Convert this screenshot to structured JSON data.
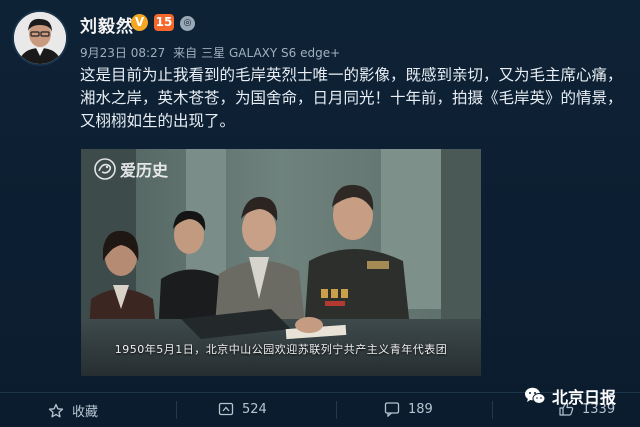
{
  "post": {
    "username": "刘毅然",
    "badge_v": "V",
    "badge_level": "15",
    "time": "9月23日 08:27",
    "source_prefix": "来自",
    "device": "三星 GALAXY S6 edge+",
    "text": "这是目前为止我看到的毛岸英烈士唯一的影像，既感到亲切，又为毛主席心痛，湘水之岸，英木苍苍，为国舍命，日月同光！十年前，拍摄《毛岸英》的情景，又栩栩如生的出现了。"
  },
  "video": {
    "logo_text": "爱历史",
    "subtitle": "1950年5月1日，北京中山公园欢迎苏联列宁共产主义青年代表团"
  },
  "toolbar": {
    "favorite_label": "收藏",
    "repost_count": "524",
    "comment_count": "189",
    "like_count": "1339"
  },
  "watermark": {
    "text": "北京日报"
  },
  "colors": {
    "background": "#0c1f33",
    "badge_v": "#f5a623",
    "badge_level": "#f5672a"
  }
}
